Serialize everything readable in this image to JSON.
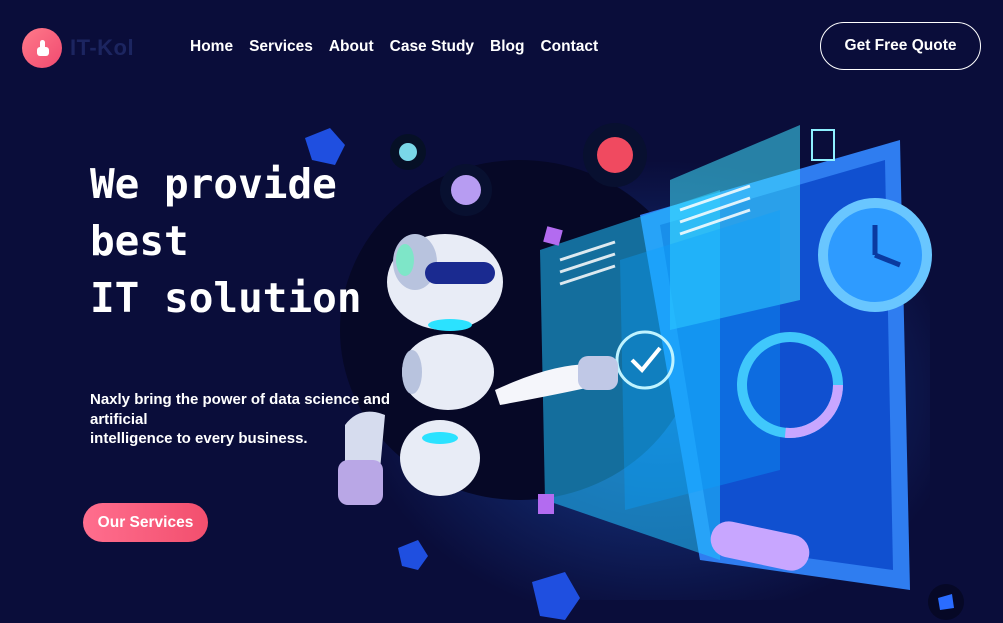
{
  "brand": {
    "name": "IT-Kol",
    "logo_icon": "hand-pointer-icon"
  },
  "nav": {
    "items": [
      {
        "label": "Home"
      },
      {
        "label": "Services"
      },
      {
        "label": "About"
      },
      {
        "label": "Case Study"
      },
      {
        "label": "Blog"
      },
      {
        "label": "Contact"
      }
    ],
    "cta_label": "Get Free Quote"
  },
  "hero": {
    "title": "We provide\nbest\nIT solution",
    "description": "Naxly bring the power of data science and artificial\nintelligence to every business.",
    "button_label": "Our Services"
  },
  "colors": {
    "background": "#0a0d3a",
    "accent": "#f24f6e",
    "logo_text": "#1c2560"
  }
}
